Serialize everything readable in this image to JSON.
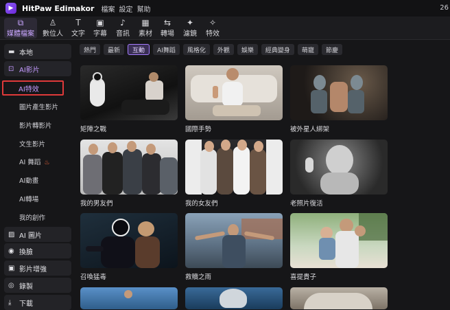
{
  "titlebar": {
    "app_name": "HitPaw Edimakor",
    "menu": [
      "檔案",
      "設定",
      "幫助"
    ],
    "right_text": "26"
  },
  "toolbar": {
    "tools": [
      {
        "label": "媒體檔案",
        "icon": "media-icon"
      },
      {
        "label": "數位人",
        "icon": "avatar-icon"
      },
      {
        "label": "文字",
        "icon": "text-icon"
      },
      {
        "label": "字幕",
        "icon": "subtitle-icon"
      },
      {
        "label": "音訊",
        "icon": "audio-icon"
      },
      {
        "label": "素材",
        "icon": "assets-icon"
      },
      {
        "label": "轉場",
        "icon": "transition-icon"
      },
      {
        "label": "濾鏡",
        "icon": "filter-icon"
      },
      {
        "label": "特效",
        "icon": "effects-icon"
      }
    ],
    "active": "媒體檔案"
  },
  "sidebar": {
    "sections": [
      {
        "label": "本地",
        "icon": "folder-icon"
      },
      {
        "label": "AI影片",
        "icon": "ai-video-icon"
      },
      {
        "label": "AI 圖片",
        "icon": "ai-image-icon"
      },
      {
        "label": "換臉",
        "icon": "face-swap-icon"
      },
      {
        "label": "影片增強",
        "icon": "enhance-icon"
      },
      {
        "label": "錄製",
        "icon": "record-icon"
      },
      {
        "label": "下載",
        "icon": "download-icon"
      }
    ],
    "ai_video_sub": [
      "AI特效",
      "圖片產生影片",
      "影片轉影片",
      "文生影片",
      "AI 舞蹈",
      "AI動畫",
      "AI轉場",
      "我的創作"
    ],
    "selected_sub": "AI特效"
  },
  "filters": {
    "items": [
      "熱門",
      "最新",
      "互動",
      "AI舞蹈",
      "風格化",
      "外觀",
      "娛樂",
      "經典變身",
      "萌寵",
      "節慶"
    ],
    "active": "互動"
  },
  "cards": [
    {
      "title": "矩陣之戰"
    },
    {
      "title": "國際手勢"
    },
    {
      "title": "被外星人綁架"
    },
    {
      "title": "我的男友們"
    },
    {
      "title": "我的女友們"
    },
    {
      "title": "老照片復活"
    },
    {
      "title": "召喚猛毒"
    },
    {
      "title": "救贖之雨"
    },
    {
      "title": "喜提貴子"
    }
  ]
}
